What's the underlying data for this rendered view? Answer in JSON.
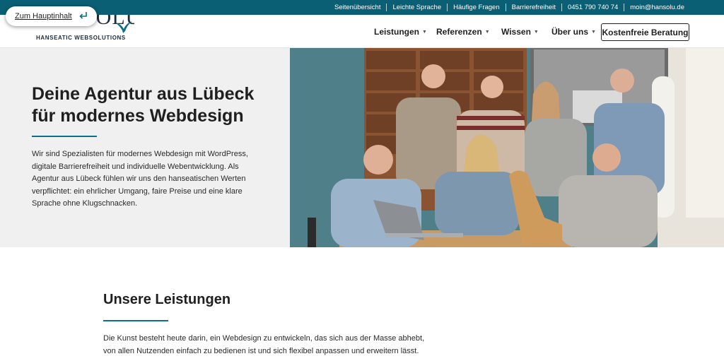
{
  "topbar": {
    "links": [
      "Seitenübersicht",
      "Leichte Sprache",
      "Häufige Fragen",
      "Barrierefreiheit",
      "0451 790 740 74",
      "moin@hansolu.de"
    ]
  },
  "skip_link": {
    "label": "Zum Hauptinhalt",
    "icon": "enter-arrow-icon"
  },
  "logo": {
    "wordmark": "HANSOLU",
    "tagline": "HANSEATIC WEBSOLUTIONS",
    "icon": "seagull-icon"
  },
  "nav": {
    "items": [
      "Leistungen",
      "Referenzen",
      "Wissen",
      "Über uns"
    ],
    "cta": "Kostenfreie Beratung"
  },
  "hero": {
    "title_line1": "Deine Agentur aus Lübeck",
    "title_line2": "für modernes Webdesign",
    "text": "Wir sind Spezialisten für modernes Webdesign mit WordPress, digitale Barrierefreiheit und individuelle Webentwicklung. Als Agentur aus Lübeck fühlen wir uns den hanseatischen Werten verpflichtet: ein ehrlicher Umgang, faire Preise und eine klare Sprache ohne Klugschnacken."
  },
  "services": {
    "title": "Unsere Leistungen",
    "text": "Die Kunst besteht heute darin, ein Webdesign zu entwickeln, das sich aus der Masse abhebt, von allen Nutzenden einfach zu bedienen ist und sich flexibel anpassen und erweitern lässt."
  },
  "colors": {
    "brand": "#0b5f74",
    "accent_rule": "#0b6f86",
    "hero_bg": "#f0f0f0"
  }
}
